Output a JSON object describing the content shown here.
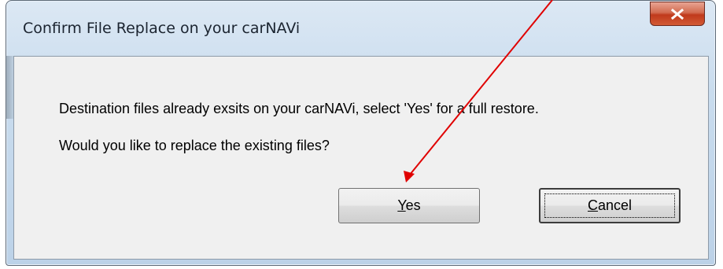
{
  "window": {
    "title": "Confirm File Replace on your carNAVi",
    "close_icon": "close-icon"
  },
  "message": {
    "line1": "Destination files already exsits on your carNAVi, select 'Yes' for a full restore.",
    "line2": "Would you like to replace the existing files?"
  },
  "buttons": {
    "yes": {
      "accel": "Y",
      "rest": "es"
    },
    "cancel": {
      "accel": "C",
      "rest": "ancel"
    }
  },
  "annotation": {
    "arrow_color": "#e00000",
    "arrow_icon": "arrow-pointing-to-yes-button"
  },
  "colors": {
    "close_button": "#c03a1c",
    "panel": "#f0f0f0",
    "frame": "#c9dcee"
  }
}
